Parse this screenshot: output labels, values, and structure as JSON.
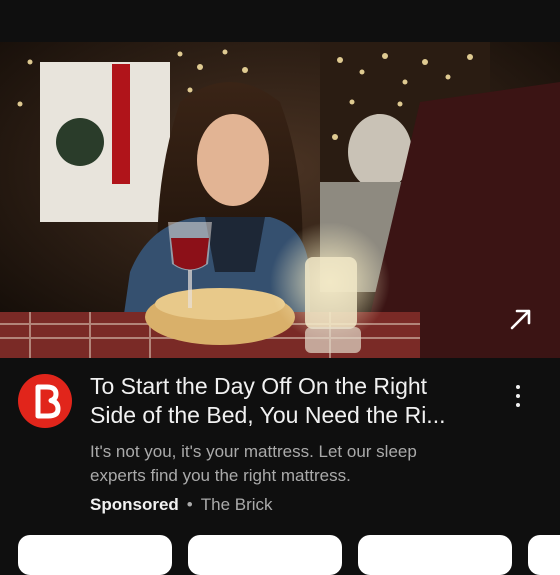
{
  "ad": {
    "title_line1": "To Start the Day Off On the Right",
    "title_line2": "Side of the Bed, You Need the Ri...",
    "description_line1": "It's not you, it's your mattress. Let our sleep",
    "description_line2": "experts find you the right mattress.",
    "sponsored_label": "Sponsored",
    "separator": "•",
    "advertiser": "The Brick",
    "brand_color": "#e1251b"
  },
  "icons": {
    "open": "arrow-up-right-icon",
    "menu": "more-vert-icon",
    "brand": "the-brick-logo"
  }
}
